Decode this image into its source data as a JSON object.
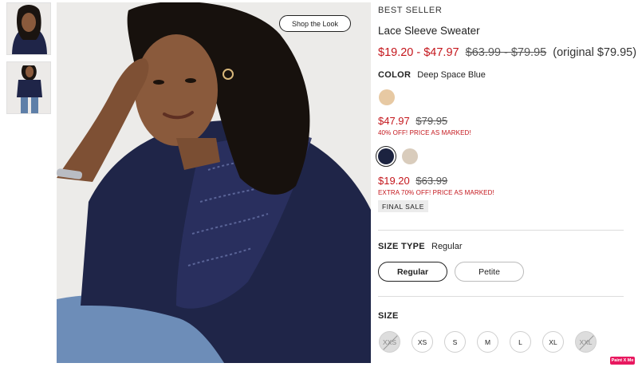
{
  "gallery": {
    "shop_the_look": "Shop the Look",
    "thumbnails": [
      "thumbnail-closeup",
      "thumbnail-full-body"
    ]
  },
  "product": {
    "eyebrow": "BEST SELLER",
    "title": "Lace Sleeve Sweater",
    "price_range_sale": "$19.20 - $47.97",
    "price_range_compare": "$63.99 - $79.95",
    "price_original_note": "(original $79.95)"
  },
  "color": {
    "label": "COLOR",
    "selected": "Deep Space Blue",
    "swatch_top": "#e7c9a3",
    "group_a": {
      "sale_price": "$47.97",
      "compare_price": "$79.95",
      "note": "40% OFF! PRICE AS MARKED!"
    },
    "swatch_selected": "#1c2340",
    "swatch_beige": "#d9ccbc",
    "group_b": {
      "sale_price": "$19.20",
      "compare_price": "$63.99",
      "note": "EXTRA 70% OFF! PRICE AS MARKED!"
    },
    "final_sale": "FINAL SALE"
  },
  "size_type": {
    "label": "SIZE TYPE",
    "selected": "Regular",
    "options": [
      "Regular",
      "Petite"
    ]
  },
  "size": {
    "label": "SIZE",
    "options": [
      "XXS",
      "XS",
      "S",
      "M",
      "L",
      "XL",
      "XXL"
    ],
    "unavailable": [
      "XXS",
      "XXL"
    ]
  },
  "badge": "Paint X Me",
  "colors": {
    "sale_red": "#c4161c",
    "sweater_navy": "#1f2548",
    "badge_pink": "#e8185f"
  }
}
